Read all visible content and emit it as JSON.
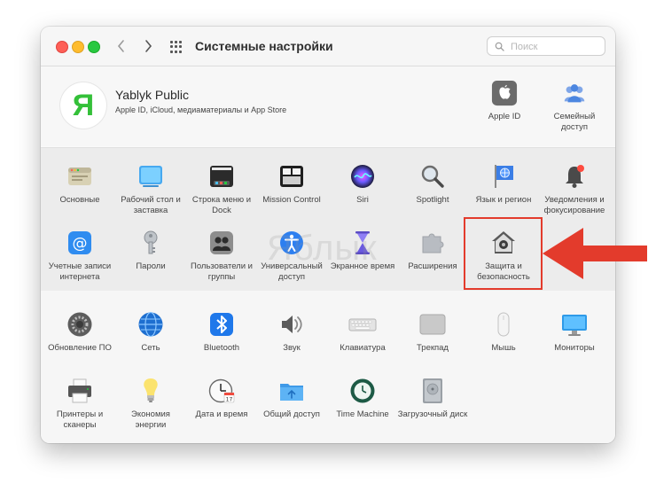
{
  "window": {
    "title": "Системные настройки"
  },
  "search": {
    "placeholder": "Поиск"
  },
  "account": {
    "avatar_letter": "Я",
    "name": "Yablyk Public",
    "subtitle": "Apple ID, iCloud, медиаматериалы и App Store",
    "items": [
      {
        "label": "Apple ID",
        "icon": "apple-id-icon"
      },
      {
        "label": "Семейный доступ",
        "icon": "family-sharing-icon"
      }
    ]
  },
  "sections": {
    "row1": [
      {
        "label": "Основные",
        "icon": "general-icon"
      },
      {
        "label": "Рабочий стол и заставка",
        "icon": "desktop-icon"
      },
      {
        "label": "Строка меню и Dock",
        "icon": "dock-icon"
      },
      {
        "label": "Mission Control",
        "icon": "mission-control-icon"
      },
      {
        "label": "Siri",
        "icon": "siri-icon"
      },
      {
        "label": "Spotlight",
        "icon": "spotlight-icon"
      },
      {
        "label": "Язык и регион",
        "icon": "language-icon"
      },
      {
        "label": "Уведомления и фокусирование",
        "icon": "notifications-icon"
      }
    ],
    "row2": [
      {
        "label": "Учетные записи интернета",
        "icon": "internet-accounts-icon"
      },
      {
        "label": "Пароли",
        "icon": "passwords-icon"
      },
      {
        "label": "Пользователи и группы",
        "icon": "users-icon"
      },
      {
        "label": "Универсальный доступ",
        "icon": "accessibility-icon"
      },
      {
        "label": "Экранное время",
        "icon": "screen-time-icon"
      },
      {
        "label": "Расширения",
        "icon": "extensions-icon"
      },
      {
        "label": "Защита и безопасность",
        "icon": "security-icon"
      }
    ],
    "row3": [
      {
        "label": "Обновление ПО",
        "icon": "software-update-icon"
      },
      {
        "label": "Сеть",
        "icon": "network-icon"
      },
      {
        "label": "Bluetooth",
        "icon": "bluetooth-icon"
      },
      {
        "label": "Звук",
        "icon": "sound-icon"
      },
      {
        "label": "Клавиатура",
        "icon": "keyboard-icon"
      },
      {
        "label": "Трекпад",
        "icon": "trackpad-icon"
      },
      {
        "label": "Мышь",
        "icon": "mouse-icon"
      },
      {
        "label": "Мониторы",
        "icon": "displays-icon"
      }
    ],
    "row4": [
      {
        "label": "Принтеры и сканеры",
        "icon": "printers-icon"
      },
      {
        "label": "Экономия энергии",
        "icon": "energy-icon"
      },
      {
        "label": "Дата и время",
        "icon": "date-time-icon"
      },
      {
        "label": "Общий доступ",
        "icon": "sharing-icon"
      },
      {
        "label": "Time Machine",
        "icon": "time-machine-icon"
      },
      {
        "label": "Загрузочный диск",
        "icon": "startup-disk-icon"
      }
    ]
  },
  "watermark": "Яблык",
  "colors": {
    "highlight": "#e33b2c",
    "arrow": "#e33b2c",
    "avatar_letter": "#34c039"
  }
}
